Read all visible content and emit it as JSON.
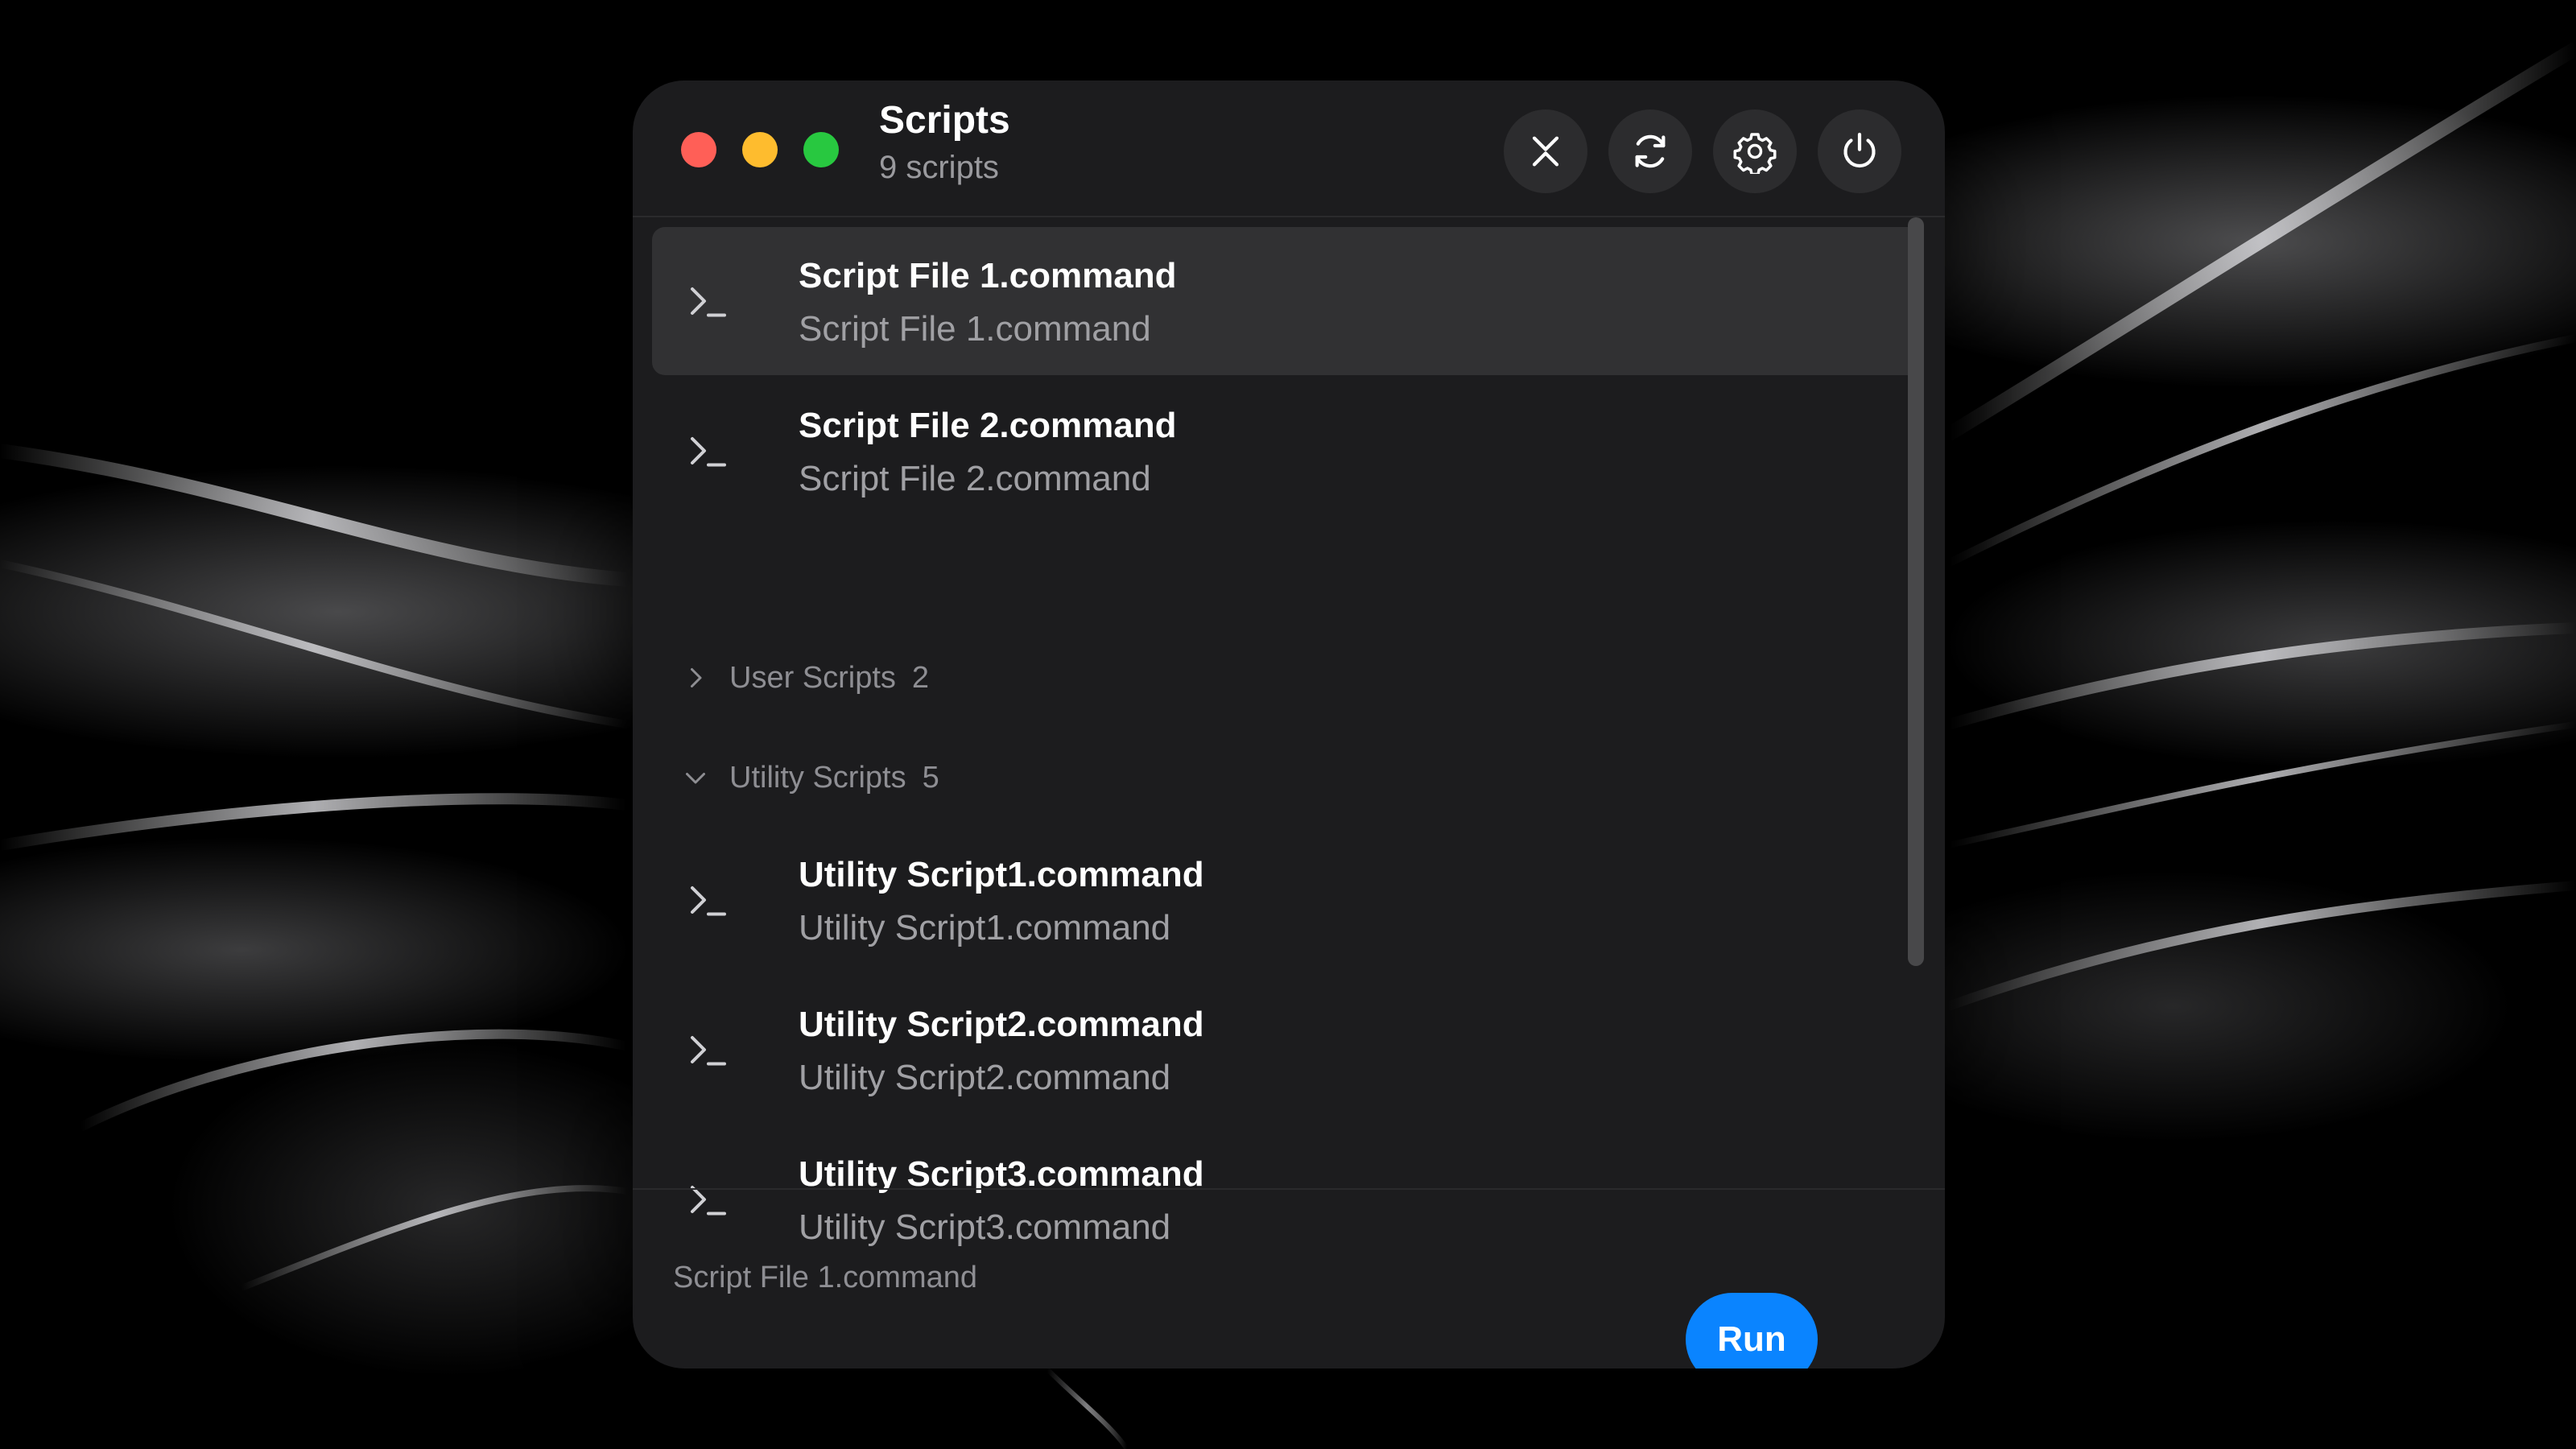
{
  "window": {
    "title": "Scripts",
    "subtitle": "9 scripts"
  },
  "toolbar": {
    "buttons": [
      {
        "name": "collapse",
        "icon": "collapse-arrows-icon"
      },
      {
        "name": "refresh",
        "icon": "refresh-icon"
      },
      {
        "name": "settings",
        "icon": "gear-icon"
      },
      {
        "name": "quit",
        "icon": "power-icon"
      }
    ]
  },
  "scripts": [
    {
      "title": "Script File 1.command",
      "subtitle": "Script File 1.command",
      "selected": true,
      "icon": "terminal-icon"
    },
    {
      "title": "Script File 2.command",
      "subtitle": "Script File 2.command",
      "selected": false,
      "icon": "terminal-icon"
    }
  ],
  "groups": [
    {
      "label": "User Scripts",
      "count": "2",
      "expanded": false
    },
    {
      "label": "Utility Scripts",
      "count": "5",
      "expanded": true
    }
  ],
  "utility_scripts": [
    {
      "title": "Utility Script1.command",
      "subtitle": "Utility Script1.command",
      "icon": "terminal-icon"
    },
    {
      "title": "Utility Script2.command",
      "subtitle": "Utility Script2.command",
      "icon": "terminal-icon"
    },
    {
      "title": "Utility Script3.command",
      "subtitle": "Utility Script3.command",
      "icon": "terminal-icon"
    }
  ],
  "footer": {
    "selected_label": "Script File 1.command",
    "run_label": "Run"
  },
  "colors": {
    "accent": "#0a84ff",
    "close": "#ff5f57",
    "minimize": "#febc2e",
    "zoom": "#28c840"
  }
}
